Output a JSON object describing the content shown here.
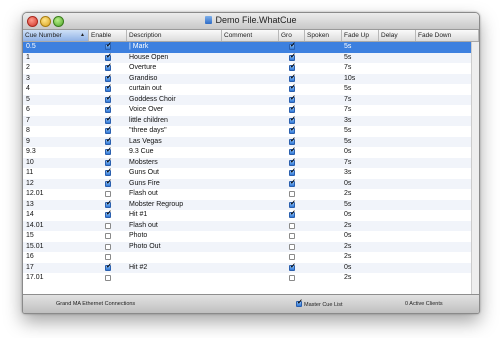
{
  "window": {
    "title": "Demo File.WhatCue"
  },
  "columns": [
    {
      "label": "Cue Number",
      "sorted": true
    },
    {
      "label": "Enable"
    },
    {
      "label": "Description"
    },
    {
      "label": "Comment"
    },
    {
      "label": "Gro"
    },
    {
      "label": "Spoken"
    },
    {
      "label": "Fade Up"
    },
    {
      "label": "Delay"
    },
    {
      "label": "Fade Down"
    }
  ],
  "rows": [
    {
      "cue": "0.5",
      "enabled": true,
      "description": "| Mark",
      "go": true,
      "fade_up": "5s"
    },
    {
      "cue": "1",
      "enabled": true,
      "description": "House Open",
      "go": true,
      "fade_up": "5s"
    },
    {
      "cue": "2",
      "enabled": true,
      "description": "Overture",
      "go": true,
      "fade_up": "7s"
    },
    {
      "cue": "3",
      "enabled": true,
      "description": "Grandiso",
      "go": true,
      "fade_up": "10s"
    },
    {
      "cue": "4",
      "enabled": true,
      "description": "curtain out",
      "go": true,
      "fade_up": "5s"
    },
    {
      "cue": "5",
      "enabled": true,
      "description": "Goddess Choir",
      "go": true,
      "fade_up": "7s"
    },
    {
      "cue": "6",
      "enabled": true,
      "description": "Voice Over",
      "go": true,
      "fade_up": "7s"
    },
    {
      "cue": "7",
      "enabled": true,
      "description": "little children",
      "go": true,
      "fade_up": "3s"
    },
    {
      "cue": "8",
      "enabled": true,
      "description": "\"three days\"",
      "go": true,
      "fade_up": "5s"
    },
    {
      "cue": "9",
      "enabled": true,
      "description": "Las Vegas",
      "go": true,
      "fade_up": "5s"
    },
    {
      "cue": "9.3",
      "enabled": true,
      "description": "9.3 Cue",
      "go": true,
      "fade_up": "0s"
    },
    {
      "cue": "10",
      "enabled": true,
      "description": "Mobsters",
      "go": true,
      "fade_up": "7s"
    },
    {
      "cue": "11",
      "enabled": true,
      "description": "Guns Out",
      "go": true,
      "fade_up": "3s"
    },
    {
      "cue": "12",
      "enabled": true,
      "description": "Guns Fire",
      "go": true,
      "fade_up": "0s"
    },
    {
      "cue": "12.01",
      "enabled": false,
      "description": "Flash out",
      "go": false,
      "fade_up": "2s"
    },
    {
      "cue": "13",
      "enabled": true,
      "description": "Mobster Regroup",
      "go": true,
      "fade_up": "5s"
    },
    {
      "cue": "14",
      "enabled": true,
      "description": "Hit #1",
      "go": true,
      "fade_up": "0s"
    },
    {
      "cue": "14.01",
      "enabled": false,
      "description": "Flash out",
      "go": false,
      "fade_up": "2s"
    },
    {
      "cue": "15",
      "enabled": false,
      "description": "Photo",
      "go": false,
      "fade_up": "0s"
    },
    {
      "cue": "15.01",
      "enabled": false,
      "description": "Photo Out",
      "go": false,
      "fade_up": "2s"
    },
    {
      "cue": "16",
      "enabled": false,
      "description": "",
      "go": false,
      "fade_up": "2s"
    },
    {
      "cue": "17",
      "enabled": true,
      "description": "Hit #2",
      "go": true,
      "fade_up": "0s"
    },
    {
      "cue": "17.01",
      "enabled": false,
      "description": "",
      "go": false,
      "fade_up": "2s"
    }
  ],
  "selected_row": 0,
  "footer": {
    "connection": "Grand MA Ethernet Connections",
    "master_cue_list_label": "Master Cue List",
    "master_cue_list_checked": true,
    "clients": "0 Active Clients"
  },
  "colors": {
    "selection": "#3d80df",
    "accent": "#2e77d7"
  }
}
